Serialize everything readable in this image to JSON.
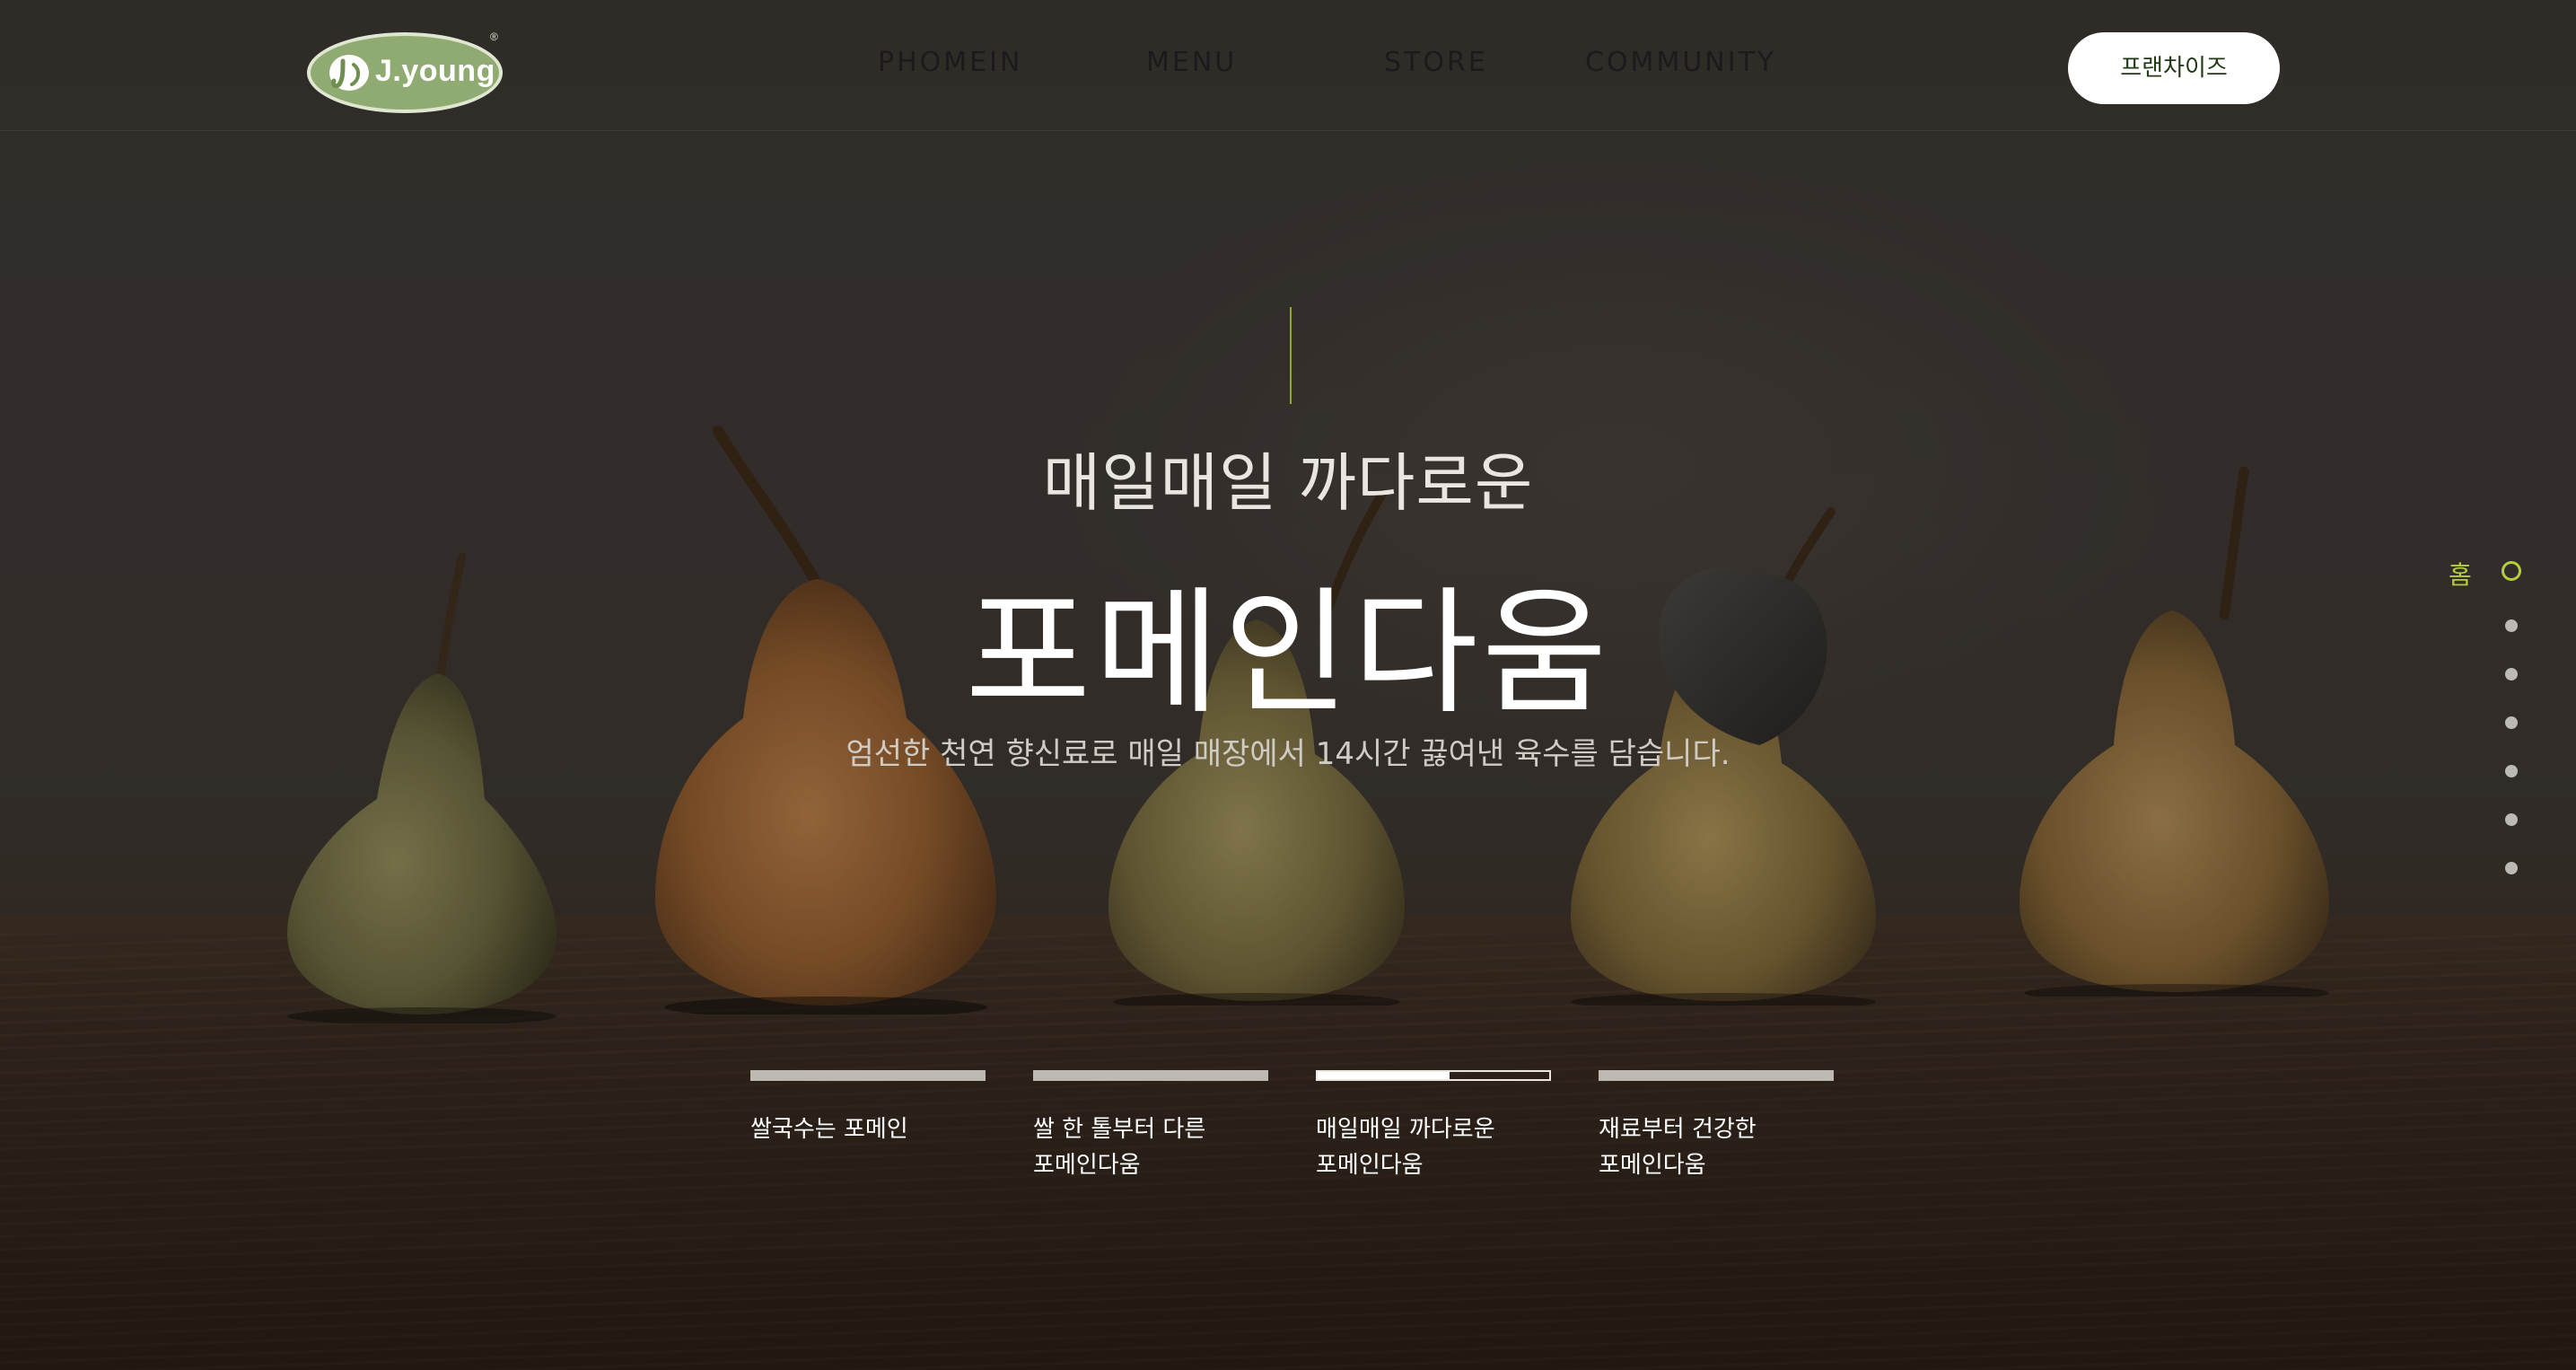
{
  "header": {
    "logo": {
      "text": "J.young",
      "reg": "®"
    },
    "nav": [
      {
        "label": "PHOMEIN"
      },
      {
        "label": "MENU"
      },
      {
        "label": "STORE"
      },
      {
        "label": "COMMUNITY"
      }
    ],
    "franchise_label": "프랜차이즈"
  },
  "hero": {
    "subtitle": "매일매일 까다로운",
    "title": "포메인다움",
    "description": "엄선한 천연 향신료로 매일 매장에서 14시간 끓여낸 육수를 담습니다."
  },
  "tabs": [
    {
      "label": "쌀국수는 포메인",
      "progress": 1.0
    },
    {
      "label": "쌀 한 톨부터 다른\n포메인다움",
      "progress": 1.0
    },
    {
      "label": "매일매일 까다로운\n포메인다움",
      "progress": 0.57,
      "active": true
    },
    {
      "label": "재료부터 건강한\n포메인다움",
      "progress": 1.0
    }
  ],
  "side_nav": {
    "active_label": "홈",
    "dot_count": 6
  },
  "colors": {
    "accent": "#b5cf3c",
    "logo_green": "#8fab71",
    "franchise_text": "#223a17"
  }
}
